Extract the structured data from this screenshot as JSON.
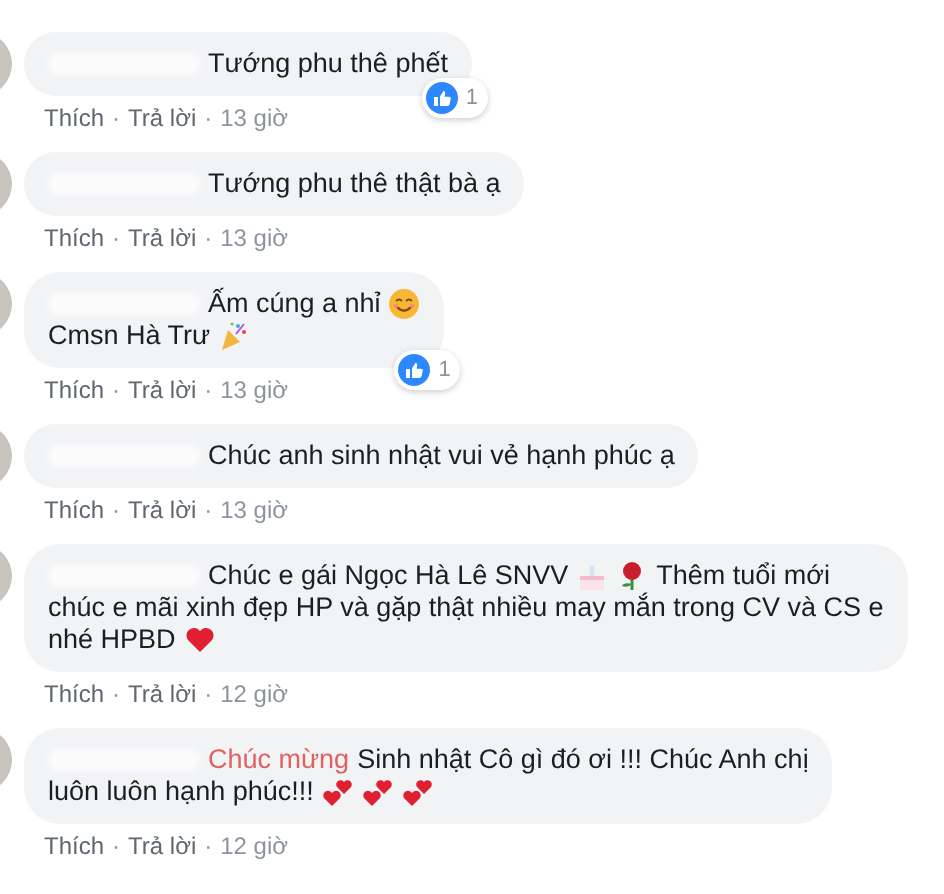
{
  "comments": [
    {
      "lines": [
        [
          {
            "kind": "redacted"
          },
          {
            "kind": "text",
            "text": "Tướng phu thê phết"
          }
        ]
      ],
      "reaction_count": "1",
      "actions": [
        {
          "kind": "link",
          "text": "Thích"
        },
        {
          "kind": "sep",
          "text": "·"
        },
        {
          "kind": "link",
          "text": "Trả lời"
        },
        {
          "kind": "sep",
          "text": "·"
        },
        {
          "kind": "time",
          "text": "13 giờ"
        }
      ]
    },
    {
      "lines": [
        [
          {
            "kind": "redacted"
          },
          {
            "kind": "text",
            "text": "Tướng phu thê thật bà ạ"
          }
        ]
      ],
      "actions": [
        {
          "kind": "link",
          "text": "Thích"
        },
        {
          "kind": "sep",
          "text": "·"
        },
        {
          "kind": "link",
          "text": "Trả lời"
        },
        {
          "kind": "sep",
          "text": "·"
        },
        {
          "kind": "time",
          "text": "13 giờ"
        }
      ]
    },
    {
      "lines": [
        [
          {
            "kind": "redacted"
          },
          {
            "kind": "text",
            "text": "Ấm cúng a nhỉ"
          },
          {
            "kind": "smile"
          }
        ],
        [
          {
            "kind": "text",
            "text": "Cmsn Hà Trư"
          },
          {
            "kind": "party"
          }
        ]
      ],
      "reaction_count": "1",
      "actions": [
        {
          "kind": "link",
          "text": "Thích"
        },
        {
          "kind": "sep",
          "text": "·"
        },
        {
          "kind": "link",
          "text": "Trả lời"
        },
        {
          "kind": "sep",
          "text": "·"
        },
        {
          "kind": "time",
          "text": "13 giờ"
        }
      ]
    },
    {
      "lines": [
        [
          {
            "kind": "redacted"
          },
          {
            "kind": "text",
            "text": "Chúc anh sinh nhật vui vẻ hạnh phúc ạ"
          }
        ]
      ],
      "actions": [
        {
          "kind": "link",
          "text": "Thích"
        },
        {
          "kind": "sep",
          "text": "·"
        },
        {
          "kind": "link",
          "text": "Trả lời"
        },
        {
          "kind": "sep",
          "text": "·"
        },
        {
          "kind": "time",
          "text": "13 giờ"
        }
      ]
    },
    {
      "lines": [
        [
          {
            "kind": "redacted"
          },
          {
            "kind": "text",
            "text": "Chúc e gái Ngọc Hà Lê SNVV"
          },
          {
            "kind": "cake"
          },
          {
            "kind": "rose"
          },
          {
            "kind": "text",
            "text": "Thêm tuổi mới"
          }
        ],
        [
          {
            "kind": "text",
            "text": "chúc e mãi xinh đẹp HP và gặp thật nhiều may mắn trong CV và CS e"
          }
        ],
        [
          {
            "kind": "text",
            "text": "nhé HPBD"
          },
          {
            "kind": "heart"
          }
        ]
      ],
      "actions": [
        {
          "kind": "link",
          "text": "Thích"
        },
        {
          "kind": "sep",
          "text": "·"
        },
        {
          "kind": "link",
          "text": "Trả lời"
        },
        {
          "kind": "sep",
          "text": "·"
        },
        {
          "kind": "time",
          "text": "12 giờ"
        }
      ]
    },
    {
      "lines": [
        [
          {
            "kind": "redacted"
          },
          {
            "kind": "highlight",
            "text": "Chúc mừng"
          },
          {
            "kind": "text",
            "text": "Sinh nhật Cô gì đó ơi !!! Chúc Anh chị"
          }
        ],
        [
          {
            "kind": "text",
            "text": "luôn luôn hạnh phúc!!!"
          },
          {
            "kind": "hearts"
          },
          {
            "kind": "hearts"
          },
          {
            "kind": "hearts"
          }
        ]
      ],
      "actions": [
        {
          "kind": "link",
          "text": "Thích"
        },
        {
          "kind": "sep",
          "text": "·"
        },
        {
          "kind": "link",
          "text": "Trả lời"
        },
        {
          "kind": "sep",
          "text": "·"
        },
        {
          "kind": "time",
          "text": "12 giờ"
        }
      ]
    }
  ]
}
